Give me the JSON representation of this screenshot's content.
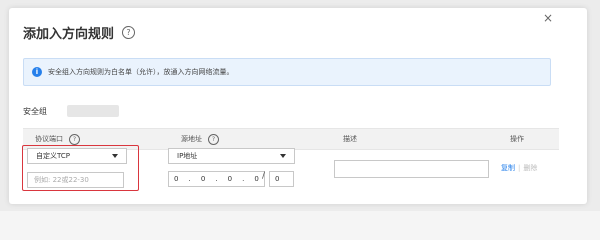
{
  "dialog": {
    "title": "添加入方向规则",
    "help_glyph": "?",
    "close_glyph": "×"
  },
  "banner": {
    "icon_glyph": "i",
    "text": "安全组入方向规则为白名单（允许），放通入方向网络流量。"
  },
  "security_group": {
    "label": "安全组"
  },
  "table": {
    "headers": {
      "protocol_port": "协议端口",
      "source": "源地址",
      "description": "描述",
      "actions": "操作"
    }
  },
  "row": {
    "protocol_select": "自定义TCP",
    "port_placeholder": "例如: 22或22-30",
    "source_select": "IP地址",
    "ip": [
      "0",
      "0",
      "0",
      "0"
    ],
    "ip_separator": ".",
    "mask_separator": "/",
    "mask": "0",
    "description_value": "",
    "copy_label": "复制",
    "separator": "|",
    "delete_label": "删除"
  },
  "colors": {
    "accent": "#2680eb",
    "highlight_border": "#d9363e",
    "banner_bg": "#eaf3fd"
  }
}
